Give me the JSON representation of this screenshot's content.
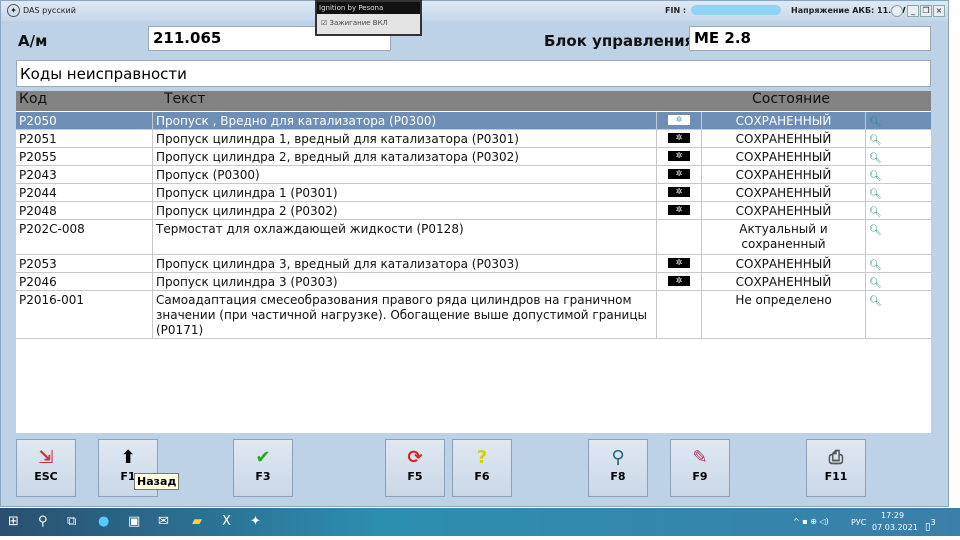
{
  "window": {
    "title": "DAS русский",
    "fin_label": "FIN :",
    "voltage": "Напряжение АКБ: 11.5 V"
  },
  "popup": {
    "title": "Ignition by Pesona",
    "checkbox": "Зажигание ВКЛ",
    "checked": true
  },
  "fields": {
    "am_label": "А/м",
    "am_value": "211.065",
    "ecu_label": "Блок управления",
    "ecu_value": "ME 2.8"
  },
  "section_title": "Коды неисправности",
  "table": {
    "headers": [
      "Код",
      "Текст",
      "Состояние"
    ],
    "rows": [
      {
        "code": "P2050",
        "text": "Пропуск , Вредно для катализатора (P0300)",
        "icon": true,
        "status": "СОХРАНЕННЫЙ"
      },
      {
        "code": "P2051",
        "text": "Пропуск цилиндра 1, вредный для катализатора (P0301)",
        "icon": true,
        "status": "СОХРАНЕННЫЙ"
      },
      {
        "code": "P2055",
        "text": "Пропуск цилиндра 2, вредный для катализатора (P0302)",
        "icon": true,
        "status": "СОХРАНЕННЫЙ"
      },
      {
        "code": "P2043",
        "text": "Пропуск (P0300)",
        "icon": true,
        "status": "СОХРАНЕННЫЙ"
      },
      {
        "code": "P2044",
        "text": "Пропуск цилиндра 1 (P0301)",
        "icon": true,
        "status": "СОХРАНЕННЫЙ"
      },
      {
        "code": "P2048",
        "text": "Пропуск цилиндра 2 (P0302)",
        "icon": true,
        "status": "СОХРАНЕННЫЙ"
      },
      {
        "code": "P202C-008",
        "text": "Термостат для охлаждающей жидкости (P0128)",
        "icon": false,
        "status": "Актуальный и сохраненный"
      },
      {
        "code": "P2053",
        "text": "Пропуск цилиндра 3, вредный для катализатора (P0303)",
        "icon": true,
        "status": "СОХРАНЕННЫЙ"
      },
      {
        "code": "P2046",
        "text": "Пропуск цилиндра 3 (P0303)",
        "icon": true,
        "status": "СОХРАНЕННЫЙ"
      },
      {
        "code": "P2016-001",
        "text": "Самоадаптация смесеобразования правого ряда цилиндров на граничном значении (при частичной нагрузке). Обогащение выше допустимой границы (P0171)",
        "icon": false,
        "status": "Не определено"
      }
    ]
  },
  "buttons": [
    {
      "key": "ESC",
      "icon": "exit-door-icon"
    },
    {
      "key": "F1",
      "icon": "arrow-up-icon"
    },
    {
      "key": "F3",
      "icon": "checkmark-icon"
    },
    {
      "key": "F5",
      "icon": "refresh-icon"
    },
    {
      "key": "F6",
      "icon": "help-icon"
    },
    {
      "key": "F8",
      "icon": "magnifier-icon"
    },
    {
      "key": "F9",
      "icon": "notepad-icon"
    },
    {
      "key": "F11",
      "icon": "printer-icon"
    }
  ],
  "tooltip": "Назад",
  "taskbar": {
    "lang": "РУС",
    "time": "17:29",
    "date": "07.03.2021",
    "notifications": "3"
  }
}
